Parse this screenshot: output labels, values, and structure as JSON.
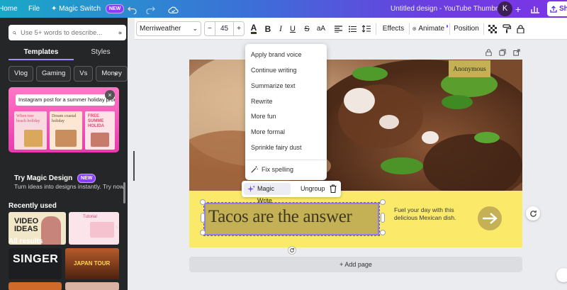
{
  "topbar": {
    "home": "Home",
    "file": "File",
    "magic_switch": "Magic Switch",
    "magic_badge": "NEW",
    "doc_title": "Untitled design - YouTube Thumbnail",
    "avatar_initial": "K",
    "share": "Sh"
  },
  "sidebar": {
    "search_placeholder": "Use 5+ words to describe...",
    "tabs": [
      "Templates",
      "Styles"
    ],
    "chips": [
      "Vlog",
      "Gaming",
      "Vs",
      "Money"
    ],
    "promo": {
      "caption": "Instagram post for a summer holiday promo",
      "card1": "When tree beach holiday",
      "card2": "Dream coastal holiday",
      "card3": "FREE SUMME HOLIDA"
    },
    "try_title": "Try Magic Design",
    "try_badge": "NEW",
    "try_sub": "Turn ideas into designs instantly. Try now.",
    "recently_used": "Recently used",
    "recent1": "VIDEO IDEAS",
    "recent2_text": "Tutorial",
    "all_results": "All results",
    "result1": "SINGER",
    "result2": "JAPAN TOUR"
  },
  "toolbar": {
    "font": "Merriweather",
    "font_size": "45",
    "minus": "−",
    "plus": "+",
    "bold": "B",
    "italic": "I",
    "underline": "U",
    "strike": "S",
    "case": "aA",
    "effects": "Effects",
    "animate": "Animate",
    "position": "Position"
  },
  "menu": {
    "items": [
      "Apply brand voice",
      "Continue writing",
      "Summarize text",
      "Rewrite",
      "More fun",
      "More formal",
      "Sprinkle fairy dust"
    ],
    "fix_spelling": "Fix spelling"
  },
  "context_bar": {
    "magic_write": "Magic Write",
    "ungroup": "Ungroup"
  },
  "design": {
    "anonymous": "Anonymous",
    "headline": "Tacos are the answer",
    "tagline": "Fuel your day with this delicious Mexican dish."
  },
  "add_page": "+ Add page",
  "colors": {
    "accent": "#8b3dff",
    "yellow_band": "#fbe969",
    "olive": "#c4b155",
    "panel": "#252627"
  }
}
